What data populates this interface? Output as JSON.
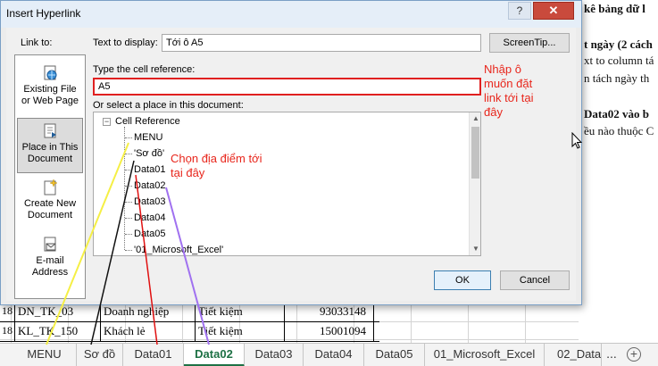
{
  "background": {
    "doc_lines": [
      {
        "text": "kê bảng dữ l",
        "bold": true
      },
      {
        "text": "t ngày (2 cách",
        "bold": true
      },
      {
        "text": "xt to column tá",
        "bold": false
      },
      {
        "text": "n tách ngày th",
        "bold": false
      },
      {
        "text": "Data02 vào b",
        "bold": true
      },
      {
        "text": "ều nào thuộc C",
        "bold": false
      }
    ],
    "rows": [
      {
        "num": "18",
        "code": "DN_TK_03",
        "type": "Doanh nghiệp",
        "product": "Tiết kiệm",
        "amount": "93033148"
      },
      {
        "num": "18",
        "code": "KL_TK_150",
        "type": "Khách lẻ",
        "product": "Tiết kiệm",
        "amount": "15001094"
      }
    ]
  },
  "dialog": {
    "title": "Insert Hyperlink",
    "help_label": "?",
    "close_label": "✕",
    "link_to_label": "Link to:",
    "text_to_display_label": "Text to display:",
    "text_to_display_value": "Tới ô A5",
    "screentip_label": "ScreenTip...",
    "cell_ref_label": "Type the cell reference:",
    "cell_ref_value": "A5",
    "place_label": "Or select a place in this document:",
    "link_to_items": [
      {
        "line1": "Existing File",
        "line2": "or Web Page",
        "icon": "globe-file-icon",
        "selected": false
      },
      {
        "line1": "Place in This",
        "line2": "Document",
        "icon": "document-place-icon",
        "selected": true
      },
      {
        "line1": "Create New",
        "line2": "Document",
        "icon": "new-document-icon",
        "selected": false
      },
      {
        "line1": "E-mail",
        "line2": "Address",
        "icon": "email-icon",
        "selected": false
      }
    ],
    "tree": {
      "root": "Cell Reference",
      "root_expander": "−",
      "items": [
        "MENU",
        "'Sơ đồ'",
        "Data01",
        "Data02",
        "Data03",
        "Data04",
        "Data05",
        "'01_Microsoft_Excel'"
      ]
    },
    "ok_label": "OK",
    "cancel_label": "Cancel"
  },
  "annotations": {
    "cell_ref_note": [
      "Nhập ô",
      "muốn đặt",
      "link tới tại",
      "đây"
    ],
    "place_note": [
      "Chọn địa điểm tới",
      "tại đây"
    ],
    "color": "#e8261c"
  },
  "tabs": {
    "items": [
      "MENU",
      "Sơ đồ",
      "Data01",
      "Data02",
      "Data03",
      "Data04",
      "Data05",
      "01_Microsoft_Excel",
      "02_Data"
    ],
    "active_index": 3,
    "more_label": "...",
    "add_label": "+"
  }
}
